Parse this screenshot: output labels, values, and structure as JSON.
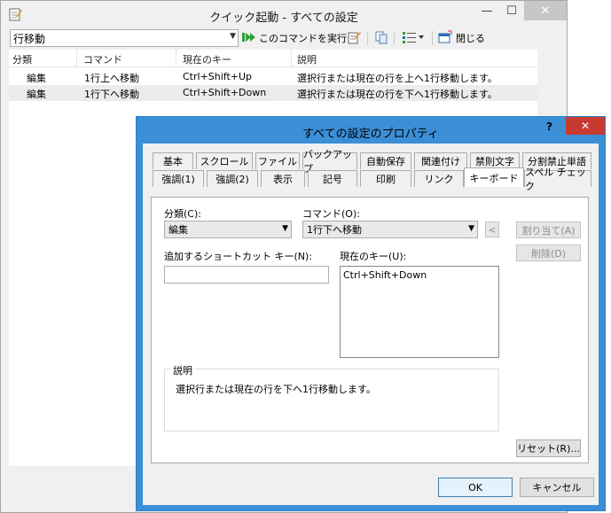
{
  "main_window": {
    "title": "クイック起動 - すべての設定",
    "controls": {
      "minimize": "—",
      "maximize": "☐",
      "close": "✕"
    },
    "toolbar": {
      "command_value": "行移動",
      "execute_label": "このコマンドを実行",
      "close_label": "閉じる"
    },
    "list": {
      "columns": [
        "分類",
        "コマンド",
        "現在のキー",
        "説明"
      ],
      "rows": [
        {
          "category": "編集",
          "command": "1行上へ移動",
          "key": "Ctrl+Shift+Up",
          "description": "選択行または現在の行を上へ1行移動します。"
        },
        {
          "category": "編集",
          "command": "1行下へ移動",
          "key": "Ctrl+Shift+Down",
          "description": "選択行または現在の行を下へ1行移動します。"
        }
      ]
    }
  },
  "dialog": {
    "title": "すべての設定のプロパティ",
    "help": "?",
    "close": "✕",
    "tabs_row1": [
      "基本",
      "スクロール",
      "ファイル",
      "バックアップ",
      "自動保存",
      "関連付け",
      "禁則文字",
      "分割禁止単語"
    ],
    "tabs_row2": [
      "強調(1)",
      "強調(2)",
      "表示",
      "記号",
      "印刷",
      "リンク",
      "キーボード",
      "スペル チェック"
    ],
    "active_tab": "キーボード",
    "keyboard": {
      "category_label": "分類(C):",
      "category_value": "編集",
      "command_label": "コマンド(O):",
      "command_value": "1行下へ移動",
      "arrow_button": "<",
      "assign_button": "割り当て(A)",
      "delete_button": "削除(D)",
      "shortcut_label": "追加するショートカット キー(N):",
      "shortcut_value": "",
      "current_keys_label": "現在のキー(U):",
      "current_keys": [
        "Ctrl+Shift+Down"
      ],
      "description_legend": "説明",
      "description_text": "選択行または現在の行を下へ1行移動します。",
      "reset_button": "リセット(R)..."
    },
    "ok_button": "OK",
    "cancel_button": "キャンセル"
  },
  "colors": {
    "dialog_frame": "#3b8fd6",
    "close_red": "#c73a32",
    "window_bg": "#f0f0f0",
    "exec_green": "#2e9e3a"
  }
}
